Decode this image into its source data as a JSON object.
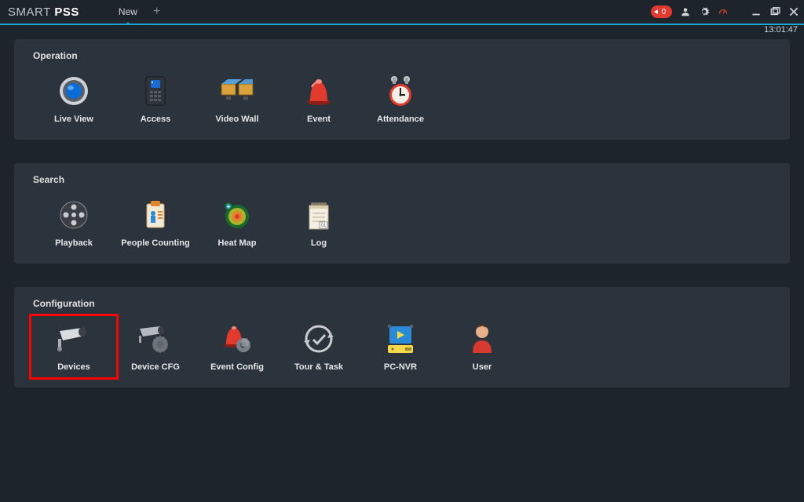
{
  "header": {
    "title_light": "SMART",
    "title_bold": "PSS",
    "tab_label": "New",
    "badge_count": "0",
    "clock": "13:01:47"
  },
  "sections": {
    "operation": {
      "title": "Operation",
      "items": {
        "live_view": "Live View",
        "access": "Access",
        "video_wall": "Video Wall",
        "event": "Event",
        "attendance": "Attendance"
      }
    },
    "search": {
      "title": "Search",
      "items": {
        "playback": "Playback",
        "people_counting": "People Counting",
        "heat_map": "Heat Map",
        "log": "Log"
      }
    },
    "configuration": {
      "title": "Configuration",
      "items": {
        "devices": "Devices",
        "device_cfg": "Device CFG",
        "event_config": "Event Config",
        "tour_task": "Tour & Task",
        "pc_nvr": "PC-NVR",
        "user": "User"
      }
    }
  }
}
